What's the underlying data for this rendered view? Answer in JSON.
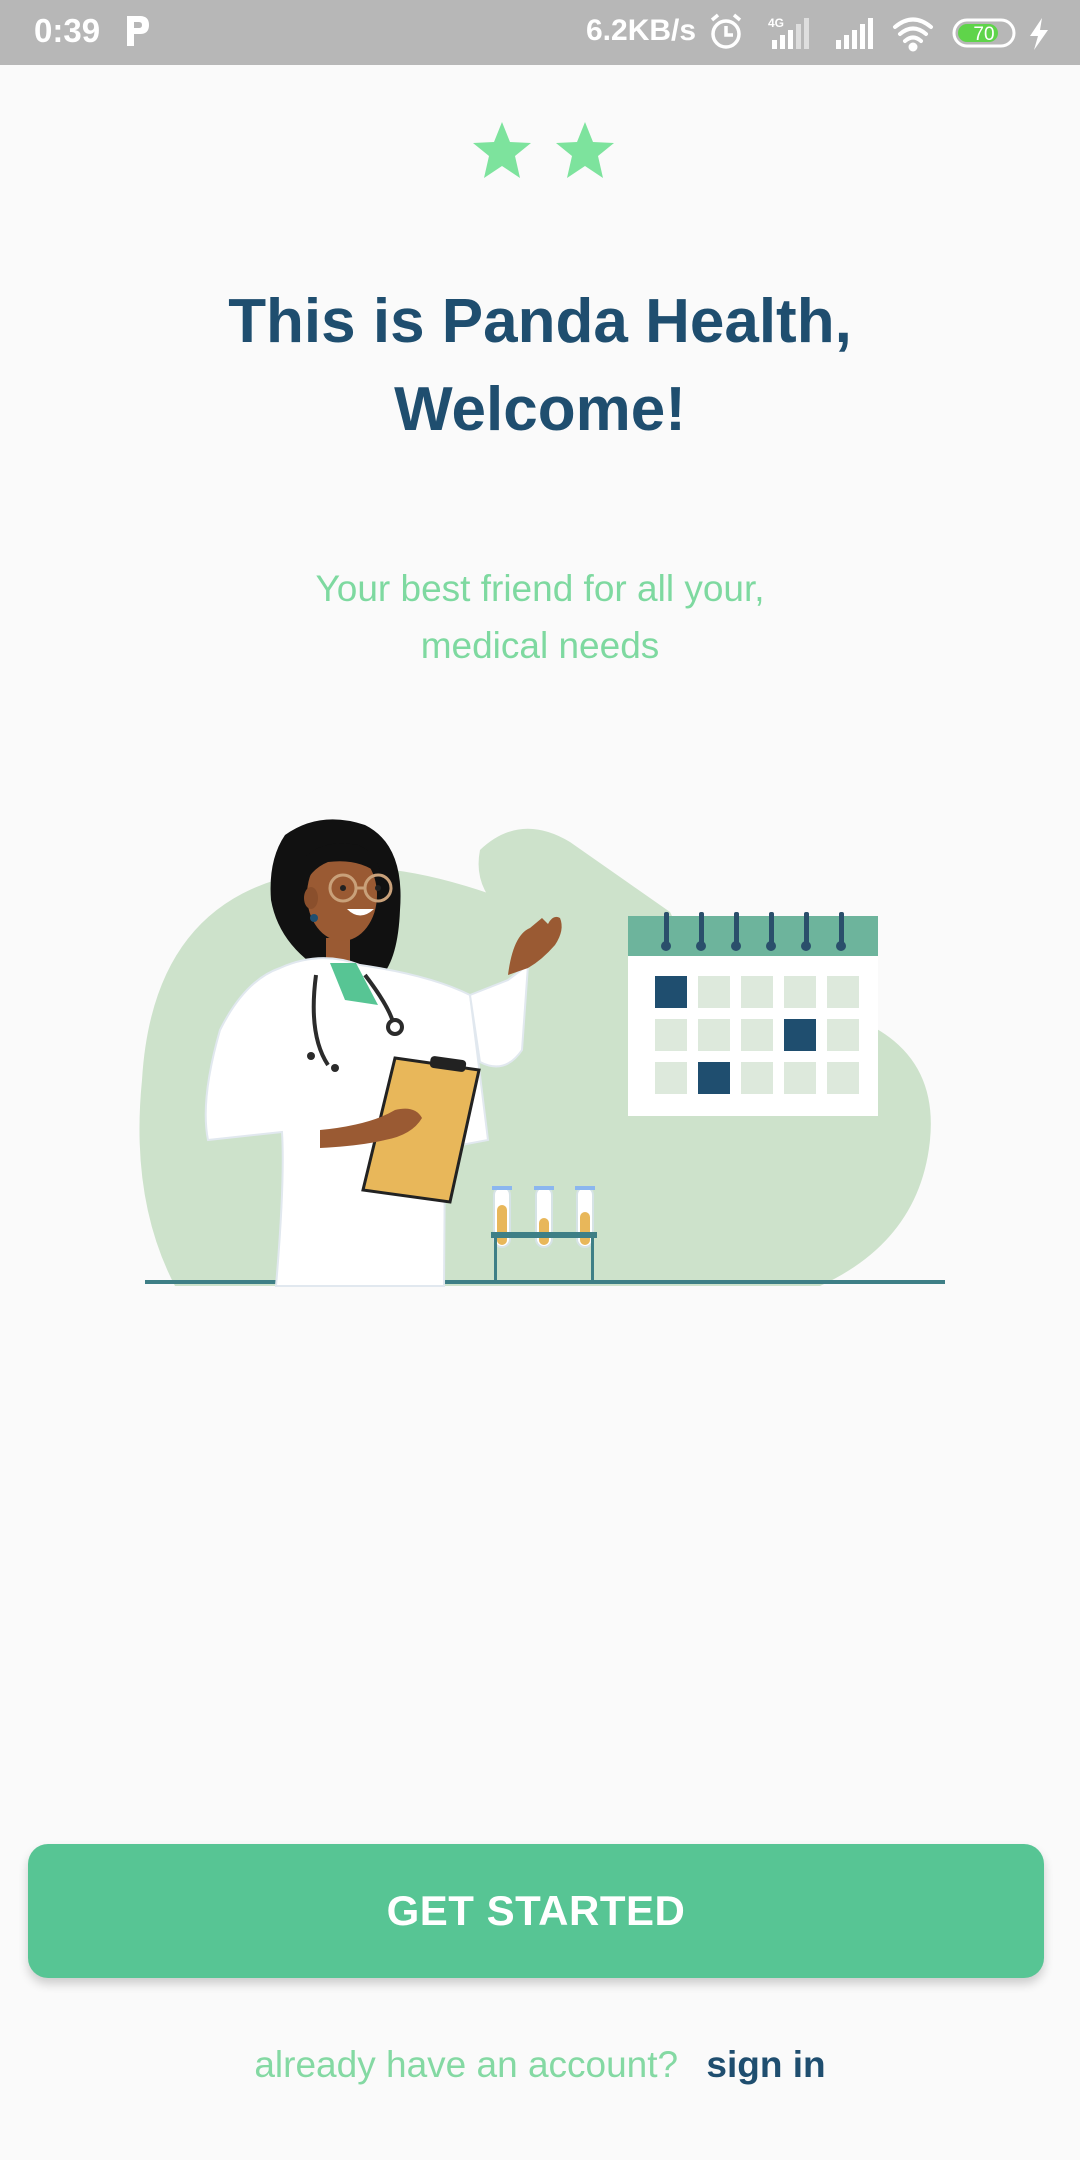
{
  "status_bar": {
    "time": "0:39",
    "network_speed": "6.2KB/s",
    "network_type": "4G",
    "battery": "70",
    "icons": [
      "parking-app-icon",
      "alarm-icon",
      "signal-icon",
      "signal-icon",
      "wifi-icon",
      "battery-icon",
      "charging-icon"
    ]
  },
  "rating": {
    "stars": 2,
    "color": "#7de39d"
  },
  "welcome": {
    "title_line1": "This is Panda Health,",
    "title_line2": "Welcome!",
    "subtitle_line1": "Your best friend for all your,",
    "subtitle_line2": "medical needs"
  },
  "illustration": {
    "subject": "doctor-with-clipboard-calendar-test-tubes"
  },
  "actions": {
    "get_started_label": "GET STARTED",
    "signin_prompt": "already have an account?",
    "signin_label": "sign in"
  },
  "colors": {
    "primary": "#57c594",
    "title": "#1f4e6f",
    "accent_text": "#7ed9a0",
    "status_bar": "#b7b7b7",
    "background": "#fafafa"
  }
}
